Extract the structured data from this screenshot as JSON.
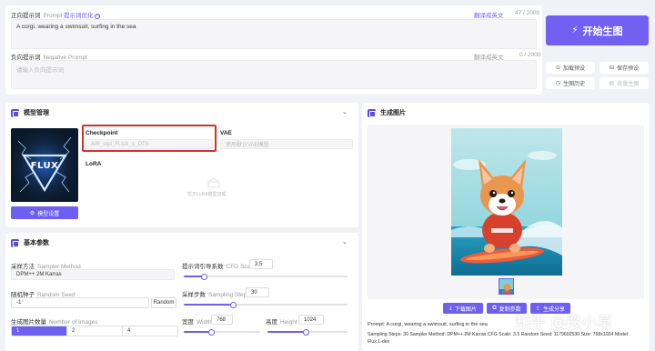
{
  "prompt": {
    "label": "正向提示词",
    "label_en": "Prompt",
    "optimize_link": "提示词优化",
    "translate_link": "翻译成英文",
    "counter": "47 / 2000",
    "value": "A corgi, wearing a swimsuit, surfing in the sea"
  },
  "negative": {
    "label": "负向提示词",
    "label_en": "Negative Prompt",
    "translate_link": "翻译成英文",
    "counter": "0 / 2000",
    "placeholder": "请输入负向提示词"
  },
  "actions": {
    "generate": "开始生图",
    "load_preset": "加载预设",
    "save_preset": "保存预设",
    "history": "生图历史",
    "batch": "批量生图"
  },
  "model": {
    "title": "模型管理",
    "checkpoint_label": "Checkpoint",
    "checkpoint_value": "AIR_utpl_FLUX_1_DTS",
    "vae_label": "VAE",
    "vae_placeholder": "使用默认VAE模型",
    "lora_label": "LoRA",
    "lora_empty": "暂无LoRA模型加载",
    "thumb_text": "FLUX",
    "settings_button": "模型设置"
  },
  "basic": {
    "title": "基本参数",
    "sampler_label": "采样方法",
    "sampler_label_en": "Sampler Method",
    "sampler_value": "DPM++ 2M Karras",
    "cfg_label": "提示词引导系数",
    "cfg_label_en": "CFG Scale",
    "cfg_value": "3.5",
    "cfg_level": 0.12,
    "seed_label": "随机种子",
    "seed_label_en": "Random Seed",
    "seed_value": "-1",
    "random_button": "Random",
    "steps_label": "采样步数",
    "steps_label_en": "Sampling Steps",
    "steps_value": "30",
    "steps_level": 0.3,
    "count_label": "生成图片数量",
    "count_label_en": "Number of Images",
    "count_options": [
      "1",
      "2",
      "4"
    ],
    "width_label": "宽度",
    "width_label_en": "Width",
    "width_value": "768",
    "width_level": 0.36,
    "height_label": "高度",
    "height_label_en": "Height",
    "height_value": "1024",
    "height_level": 0.48
  },
  "output": {
    "title": "生成图片",
    "download": "下载图片",
    "copy_params": "复制参数",
    "share": "生成分享",
    "info_line1": "Prompt: A corgi, wearing a swimsuit, surfing in the sea",
    "info_line2": "Sampling Steps: 30  Sampler Method: DPM++ 2M Karras  CFG Scale: 3.5  Random Seed: 1179602530  Size: 768x1024  Model: Flux.1-dev"
  },
  "watermark": "知乎 @段小草",
  "colors": {
    "accent": "#6d5ff0",
    "highlight_border": "#d93025",
    "background": "#f1f2f7"
  }
}
